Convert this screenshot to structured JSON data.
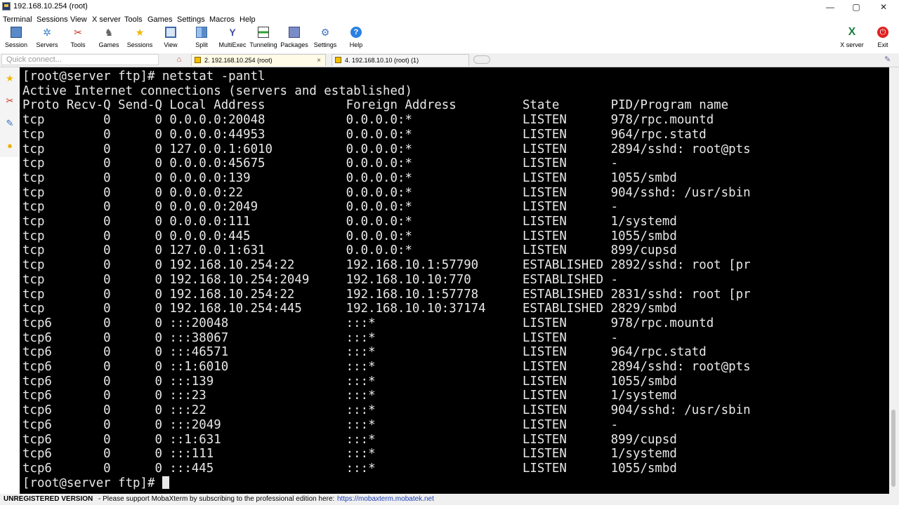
{
  "window": {
    "title": "192.168.10.254 (root)",
    "minimize": "—",
    "maximize": "▢",
    "close": "✕"
  },
  "menu": [
    "Terminal",
    "Sessions",
    "View",
    "X server",
    "Tools",
    "Games",
    "Settings",
    "Macros",
    "Help"
  ],
  "toolbar": {
    "session": "Session",
    "servers": "Servers",
    "tools": "Tools",
    "games": "Games",
    "sessions": "Sessions",
    "view": "View",
    "split": "Split",
    "multiexec": "MultiExec",
    "tunneling": "Tunneling",
    "packages": "Packages",
    "settings": "Settings",
    "help": "Help",
    "xserver": "X server",
    "exit": "Exit"
  },
  "tabs": {
    "quick_connect_placeholder": "Quick connect...",
    "tab1": "2. 192.168.10.254 (root)",
    "tab1_close": "×",
    "tab2": "4. 192.168.10.10 (root) (1)"
  },
  "terminal": {
    "lines": [
      "[root@server ftp]# netstat -pantl",
      "Active Internet connections (servers and established)",
      "Proto Recv-Q Send-Q Local Address           Foreign Address         State       PID/Program name",
      "tcp        0      0 0.0.0.0:20048           0.0.0.0:*               LISTEN      978/rpc.mountd",
      "tcp        0      0 0.0.0.0:44953           0.0.0.0:*               LISTEN      964/rpc.statd",
      "tcp        0      0 127.0.0.1:6010          0.0.0.0:*               LISTEN      2894/sshd: root@pts",
      "tcp        0      0 0.0.0.0:45675           0.0.0.0:*               LISTEN      -",
      "tcp        0      0 0.0.0.0:139             0.0.0.0:*               LISTEN      1055/smbd",
      "tcp        0      0 0.0.0.0:22              0.0.0.0:*               LISTEN      904/sshd: /usr/sbin",
      "tcp        0      0 0.0.0.0:2049            0.0.0.0:*               LISTEN      -",
      "tcp        0      0 0.0.0.0:111             0.0.0.0:*               LISTEN      1/systemd",
      "tcp        0      0 0.0.0.0:445             0.0.0.0:*               LISTEN      1055/smbd",
      "tcp        0      0 127.0.0.1:631           0.0.0.0:*               LISTEN      899/cupsd",
      "tcp        0      0 192.168.10.254:22       192.168.10.1:57790      ESTABLISHED 2892/sshd: root [pr",
      "tcp        0      0 192.168.10.254:2049     192.168.10.10:770       ESTABLISHED -",
      "tcp        0      0 192.168.10.254:22       192.168.10.1:57778      ESTABLISHED 2831/sshd: root [pr",
      "tcp        0      0 192.168.10.254:445      192.168.10.10:37174     ESTABLISHED 2829/smbd",
      "tcp6       0      0 :::20048                :::*                    LISTEN      978/rpc.mountd",
      "tcp6       0      0 :::38067                :::*                    LISTEN      -",
      "tcp6       0      0 :::46571                :::*                    LISTEN      964/rpc.statd",
      "tcp6       0      0 ::1:6010                :::*                    LISTEN      2894/sshd: root@pts",
      "tcp6       0      0 :::139                  :::*                    LISTEN      1055/smbd",
      "tcp6       0      0 :::23                   :::*                    LISTEN      1/systemd",
      "tcp6       0      0 :::22                   :::*                    LISTEN      904/sshd: /usr/sbin",
      "tcp6       0      0 :::2049                 :::*                    LISTEN      -",
      "tcp6       0      0 ::1:631                 :::*                    LISTEN      899/cupsd",
      "tcp6       0      0 :::111                  :::*                    LISTEN      1/systemd",
      "tcp6       0      0 :::445                  :::*                    LISTEN      1055/smbd"
    ],
    "prompt": "[root@server ftp]# "
  },
  "status": {
    "unregistered": "UNREGISTERED VERSION",
    "message": "-  Please support MobaXterm by subscribing to the professional edition here:",
    "link": "https://mobaxterm.mobatek.net"
  },
  "colors": {
    "terminal_bg": "#000000",
    "terminal_fg": "#e8e8e8",
    "link": "#1a3fb0"
  }
}
